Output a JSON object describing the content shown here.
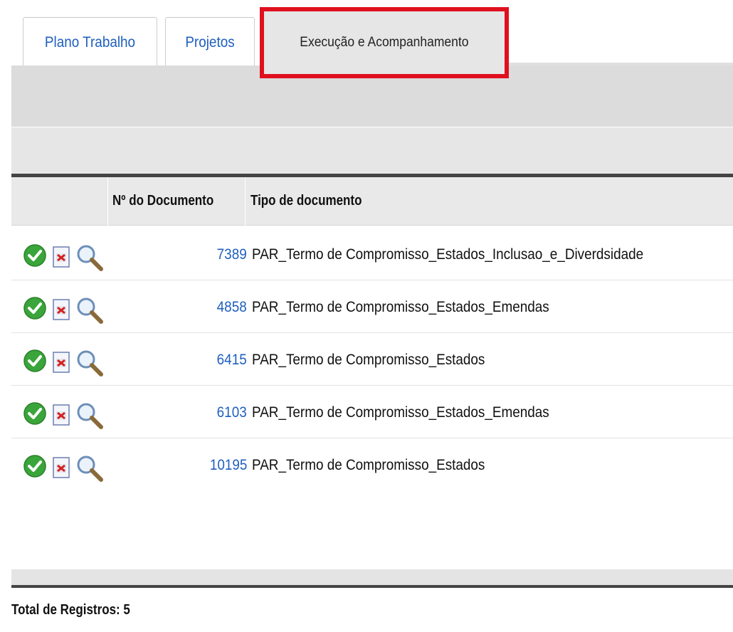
{
  "tabs": [
    {
      "label": "Plano Trabalho"
    },
    {
      "label": "Projetos"
    },
    {
      "label": "Execução e Acompanhamento"
    }
  ],
  "table": {
    "columns": [
      "",
      "Nº do Documento",
      "Tipo de documento"
    ],
    "rows": [
      {
        "numero": "7389",
        "tipo": "PAR_Termo de Compromisso_Estados_Inclusao_e_Diverdsidade"
      },
      {
        "numero": "4858",
        "tipo": "PAR_Termo de Compromisso_Estados_Emendas"
      },
      {
        "numero": "6415",
        "tipo": "PAR_Termo de Compromisso_Estados"
      },
      {
        "numero": "6103",
        "tipo": "PAR_Termo de Compromisso_Estados_Emendas"
      },
      {
        "numero": "10195",
        "tipo": "PAR_Termo de Compromisso_Estados"
      }
    ],
    "row_icons": [
      "check-circle-icon",
      "pdf-document-icon",
      "magnifier-icon"
    ]
  },
  "footer": {
    "total": "Total de Registros: 5"
  },
  "colors": {
    "link": "#1f5fbf",
    "highlight_border": "#e0101e",
    "check_green": "#3aa53a"
  }
}
